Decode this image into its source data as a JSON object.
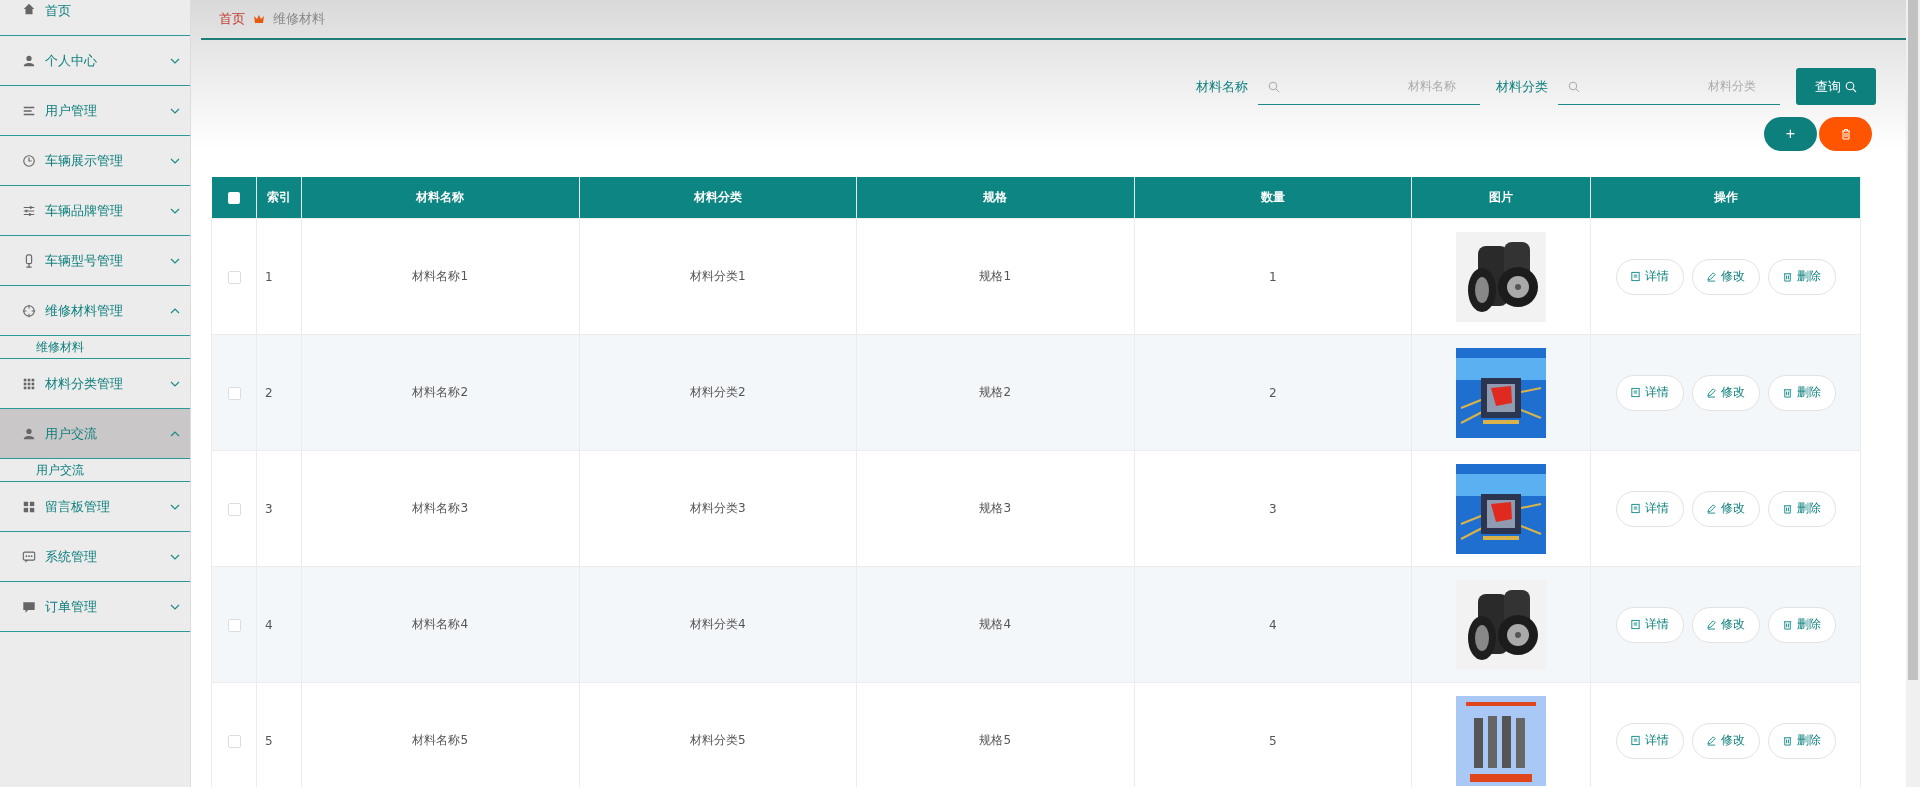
{
  "sidebar": {
    "items": [
      {
        "label": "首页",
        "has_arrow": false,
        "hovered": false
      },
      {
        "label": "个人中心",
        "has_arrow": true,
        "hovered": false
      },
      {
        "label": "用户管理",
        "has_arrow": true,
        "hovered": false
      },
      {
        "label": "车辆展示管理",
        "has_arrow": true,
        "hovered": false
      },
      {
        "label": "车辆品牌管理",
        "has_arrow": true,
        "hovered": false
      },
      {
        "label": "车辆型号管理",
        "has_arrow": true,
        "hovered": false
      },
      {
        "label": "维修材料管理",
        "has_arrow": true,
        "hovered": false,
        "expanded": true,
        "children": [
          {
            "label": "维修材料"
          }
        ]
      },
      {
        "label": "材料分类管理",
        "has_arrow": true,
        "hovered": false
      },
      {
        "label": "用户交流",
        "has_arrow": true,
        "hovered": true,
        "expanded": true,
        "children": [
          {
            "label": "用户交流"
          }
        ]
      },
      {
        "label": "留言板管理",
        "has_arrow": true,
        "hovered": false
      },
      {
        "label": "系统管理",
        "has_arrow": true,
        "hovered": false
      },
      {
        "label": "订单管理",
        "has_arrow": true,
        "hovered": false
      }
    ]
  },
  "breadcrumb": {
    "home": "首页",
    "current": "维修材料"
  },
  "search": {
    "fields": [
      {
        "label": "材料名称",
        "placeholder": "材料名称"
      },
      {
        "label": "材料分类",
        "placeholder": "材料分类"
      }
    ],
    "button": "查询"
  },
  "actions": {
    "add": "+"
  },
  "table": {
    "all_checked": false,
    "columns": [
      "索引",
      "材料名称",
      "材料分类",
      "规格",
      "数量",
      "图片",
      "操作"
    ],
    "rows": [
      {
        "checked": false,
        "index": "1",
        "name": "材料名称1",
        "category": "材料分类1",
        "spec": "规格1",
        "quantity": "1",
        "actions": [
          "详情",
          "修改",
          "删除"
        ]
      },
      {
        "checked": false,
        "index": "2",
        "name": "材料名称2",
        "category": "材料分类2",
        "spec": "规格2",
        "quantity": "2",
        "actions": [
          "详情",
          "修改",
          "删除"
        ]
      },
      {
        "checked": false,
        "index": "3",
        "name": "材料名称3",
        "category": "材料分类3",
        "spec": "规格3",
        "quantity": "3",
        "actions": [
          "详情",
          "修改",
          "删除"
        ]
      },
      {
        "checked": false,
        "index": "4",
        "name": "材料名称4",
        "category": "材料分类4",
        "spec": "规格4",
        "quantity": "4",
        "actions": [
          "详情",
          "修改",
          "删除"
        ]
      },
      {
        "checked": false,
        "index": "5",
        "name": "材料名称5",
        "category": "材料分类5",
        "spec": "规格5",
        "quantity": "5",
        "actions": [
          "详情",
          "修改",
          "删除"
        ]
      }
    ]
  }
}
